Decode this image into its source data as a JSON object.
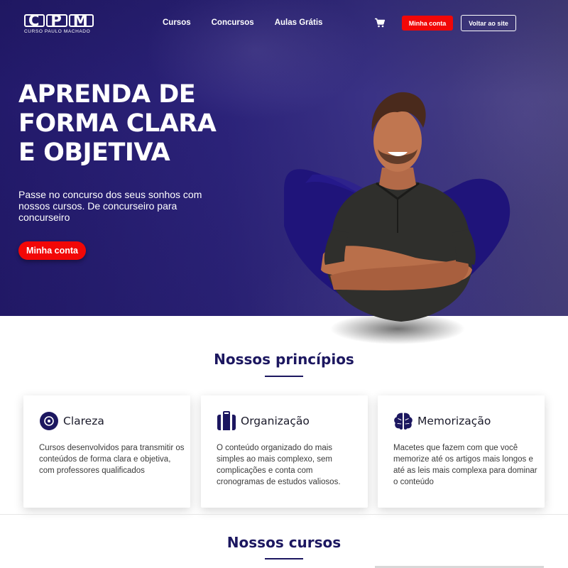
{
  "header": {
    "logo_letters": [
      "C",
      "P",
      "M"
    ],
    "logo_subtitle": "CURSO PAULO MACHADO",
    "nav": [
      "Cursos",
      "Concursos",
      "Aulas Grátis"
    ],
    "cart_icon": "cart-icon",
    "account_button": "Minha conta",
    "back_button": "Voltar ao site"
  },
  "hero": {
    "title_lines": [
      "APRENDA DE",
      "FORMA CLARA",
      "E OBJETIVA"
    ],
    "subtitle": "Passe no concurso dos seus sonhos com nossos cursos. De concurseiro para concurseiro",
    "cta": "Minha conta"
  },
  "principles": {
    "title": "Nossos princípios",
    "cards": [
      {
        "icon": "target-icon",
        "title": "Clareza",
        "text": "Cursos desenvolvidos para transmitir os conteúdos de forma clara e objetiva, com professores qualificados"
      },
      {
        "icon": "suitcase-icon",
        "title": "Organização",
        "text": "O conteúdo organizado do mais simples ao mais complexo, sem complicações e conta com cronogramas de estudos valiosos."
      },
      {
        "icon": "brain-icon",
        "title": "Memorização",
        "text": "Macetes que fazem com que você memorize até os artigos mais longos e até as leis mais complexa para dominar o conteúdo"
      }
    ]
  },
  "courses": {
    "title": "Nossos cursos"
  },
  "colors": {
    "brand_navy": "#1c1760",
    "cta_red": "#f20707",
    "hero_purple": "#2c237a"
  }
}
